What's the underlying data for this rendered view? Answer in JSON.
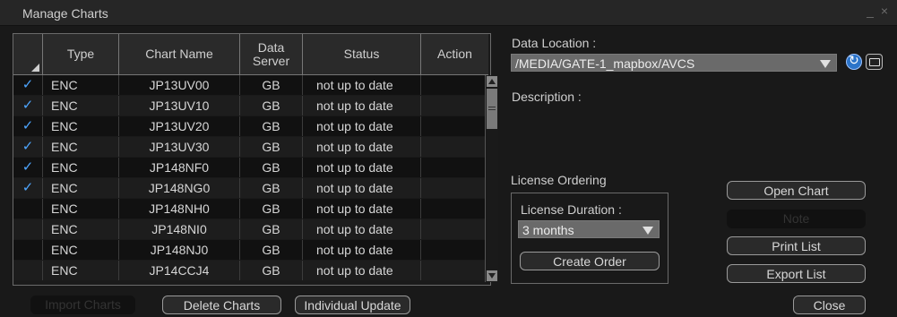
{
  "window": {
    "title": "Manage Charts",
    "controls": "_ ×"
  },
  "table": {
    "headers": {
      "type": "Type",
      "name": "Chart Name",
      "server_line1": "Data",
      "server_line2": "Server",
      "status": "Status",
      "action": "Action"
    },
    "rows": [
      {
        "checked": true,
        "type": "ENC",
        "name": "JP13UV00",
        "server": "GB",
        "status": "not up to date",
        "action": ""
      },
      {
        "checked": true,
        "type": "ENC",
        "name": "JP13UV10",
        "server": "GB",
        "status": "not up to date",
        "action": ""
      },
      {
        "checked": true,
        "type": "ENC",
        "name": "JP13UV20",
        "server": "GB",
        "status": "not up to date",
        "action": ""
      },
      {
        "checked": true,
        "type": "ENC",
        "name": "JP13UV30",
        "server": "GB",
        "status": "not up to date",
        "action": ""
      },
      {
        "checked": true,
        "type": "ENC",
        "name": "JP148NF0",
        "server": "GB",
        "status": "not up to date",
        "action": ""
      },
      {
        "checked": true,
        "type": "ENC",
        "name": "JP148NG0",
        "server": "GB",
        "status": "not up to date",
        "action": ""
      },
      {
        "checked": false,
        "type": "ENC",
        "name": "JP148NH0",
        "server": "GB",
        "status": "not up to date",
        "action": ""
      },
      {
        "checked": false,
        "type": "ENC",
        "name": "JP148NI0",
        "server": "GB",
        "status": "not up to date",
        "action": ""
      },
      {
        "checked": false,
        "type": "ENC",
        "name": "JP148NJ0",
        "server": "GB",
        "status": "not up to date",
        "action": ""
      },
      {
        "checked": false,
        "type": "ENC",
        "name": "JP14CCJ4",
        "server": "GB",
        "status": "not up to date",
        "action": ""
      }
    ]
  },
  "data_location": {
    "label": "Data Location :",
    "value": "/MEDIA/GATE-1_mapbox/AVCS"
  },
  "description": {
    "label": "Description :"
  },
  "license": {
    "section_label": "License Ordering",
    "duration_label": "License Duration :",
    "duration_value": "3 months",
    "create_order": "Create Order"
  },
  "buttons": {
    "open_chart": "Open Chart",
    "note": "Note",
    "print_list": "Print List",
    "export_list": "Export List",
    "import_charts": "Import Charts",
    "delete_charts": "Delete Charts",
    "individual_update": "Individual Update",
    "close": "Close"
  },
  "colors": {
    "check": "#4ea6ff",
    "accent_refresh": "#2c74c9"
  }
}
